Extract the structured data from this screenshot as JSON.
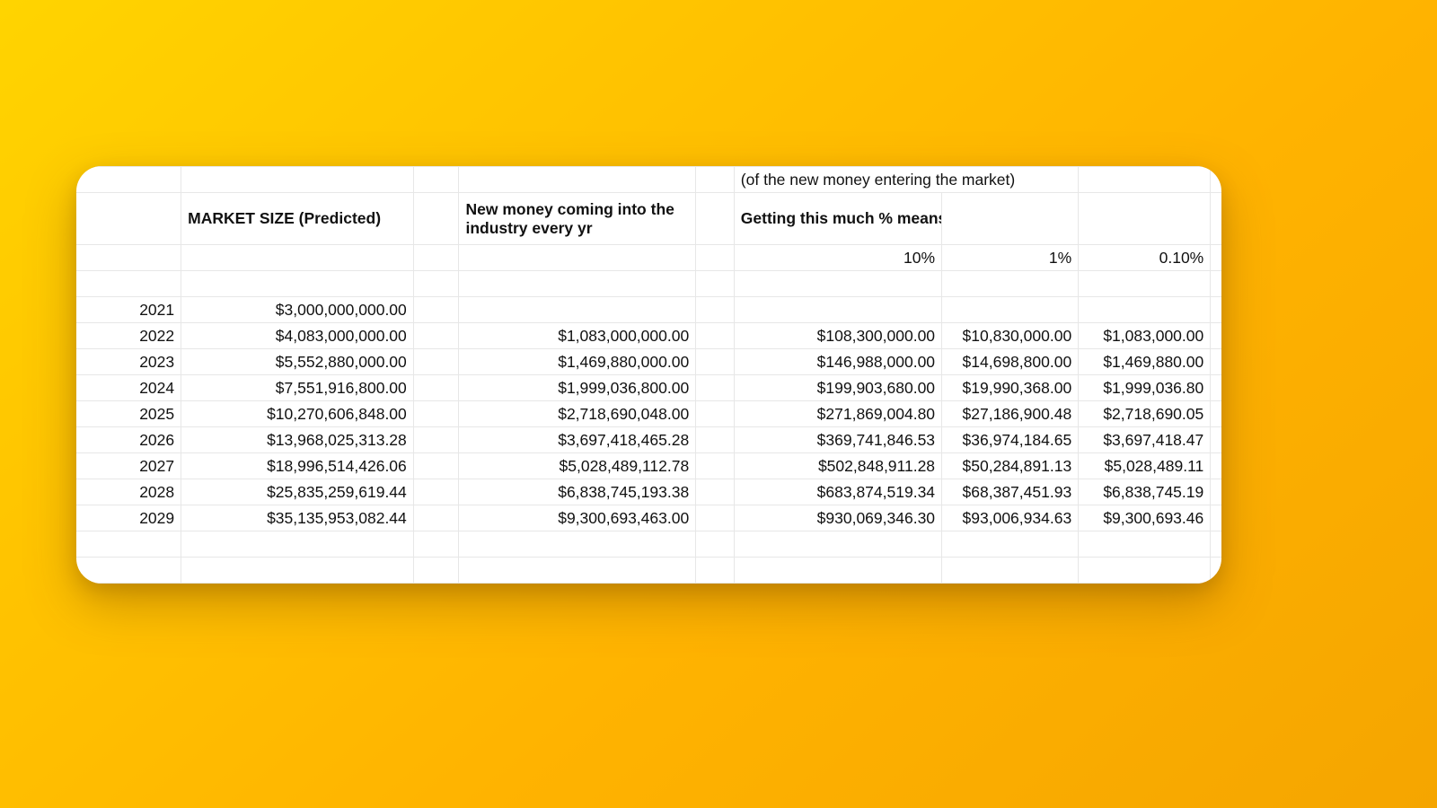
{
  "headers": {
    "note": "(of the new money entering the market)",
    "col_market": "MARKET SIZE (Predicted)",
    "col_newmoney": "New money coming into the industry every yr",
    "col_percent_label": "Getting this much % means:",
    "p10": "10%",
    "p1": "1%",
    "p01": "0.10%"
  },
  "rows": [
    {
      "year": "2021",
      "ms": "$3,000,000,000.00",
      "nm": "",
      "p10": "",
      "p1": "",
      "p01": ""
    },
    {
      "year": "2022",
      "ms": "$4,083,000,000.00",
      "nm": "$1,083,000,000.00",
      "p10": "$108,300,000.00",
      "p1": "$10,830,000.00",
      "p01": "$1,083,000.00"
    },
    {
      "year": "2023",
      "ms": "$5,552,880,000.00",
      "nm": "$1,469,880,000.00",
      "p10": "$146,988,000.00",
      "p1": "$14,698,800.00",
      "p01": "$1,469,880.00"
    },
    {
      "year": "2024",
      "ms": "$7,551,916,800.00",
      "nm": "$1,999,036,800.00",
      "p10": "$199,903,680.00",
      "p1": "$19,990,368.00",
      "p01": "$1,999,036.80"
    },
    {
      "year": "2025",
      "ms": "$10,270,606,848.00",
      "nm": "$2,718,690,048.00",
      "p10": "$271,869,004.80",
      "p1": "$27,186,900.48",
      "p01": "$2,718,690.05"
    },
    {
      "year": "2026",
      "ms": "$13,968,025,313.28",
      "nm": "$3,697,418,465.28",
      "p10": "$369,741,846.53",
      "p1": "$36,974,184.65",
      "p01": "$3,697,418.47"
    },
    {
      "year": "2027",
      "ms": "$18,996,514,426.06",
      "nm": "$5,028,489,112.78",
      "p10": "$502,848,911.28",
      "p1": "$50,284,891.13",
      "p01": "$5,028,489.11"
    },
    {
      "year": "2028",
      "ms": "$25,835,259,619.44",
      "nm": "$6,838,745,193.38",
      "p10": "$683,874,519.34",
      "p1": "$68,387,451.93",
      "p01": "$6,838,745.19"
    },
    {
      "year": "2029",
      "ms": "$35,135,953,082.44",
      "nm": "$9,300,693,463.00",
      "p10": "$930,069,346.30",
      "p1": "$93,006,934.63",
      "p01": "$9,300,693.46"
    }
  ]
}
